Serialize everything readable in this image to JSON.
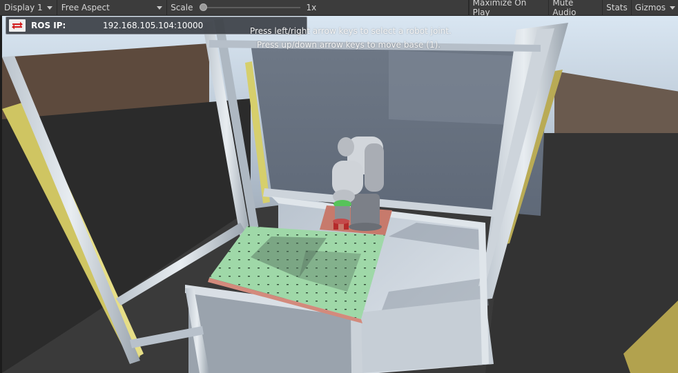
{
  "toolbar": {
    "display_label": "Display 1",
    "aspect_label": "Free Aspect",
    "scale_label": "Scale",
    "scale_value": "1x",
    "scale_fraction": 0.0,
    "maximize_label": "Maximize On Play",
    "mute_label": "Mute Audio",
    "stats_label": "Stats",
    "gizmos_label": "Gizmos"
  },
  "ros_panel": {
    "icon": "ros-connection-arrows-icon",
    "label": "ROS IP:",
    "value": "192.168.105.104:10000"
  },
  "instructions": {
    "line1": "Press left/right arrow keys to select a robot joint.",
    "line2": "Press up/down arrow keys to move base (1)."
  },
  "colors": {
    "toolbar_bg": "#3c3c3c",
    "sky": "#6b7684",
    "floor": "#3a3a3a",
    "frame": "#c9cfd6",
    "yellow_rail": "#d8d06a",
    "pegboard": "#9ed6a6",
    "robot": "#c8ccd2",
    "ros_icon_red": "#d32020"
  }
}
